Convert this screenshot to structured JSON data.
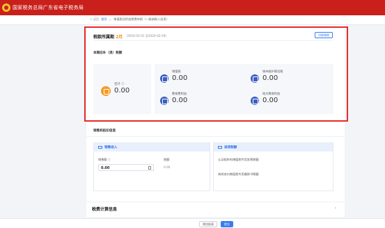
{
  "header": {
    "site_title": "国家税务总局广东省电子税务局"
  },
  "breadcrumb": {
    "back": "< 返回",
    "home": "首页",
    "separator": ">",
    "current": "增值税及附加税费申报（一般纳税人适用）"
  },
  "period": {
    "label": "税款所属期",
    "value": "2月",
    "range": "（2024-02-01 至2024-02-29）",
    "switch_button": "切换属期"
  },
  "summary": {
    "subtitle": "本期应补（退）税额",
    "total_label": "合计 ⓘ",
    "total_value": "0.00"
  },
  "taxes": [
    {
      "name": "增值税",
      "value": "0.00",
      "icon": "vat-icon"
    },
    {
      "name": "城市维护建设税",
      "value": "0.00",
      "icon": "city-tax-icon"
    },
    {
      "name": "教育费附加",
      "value": "0.00",
      "icon": "education-icon"
    },
    {
      "name": "地方教育附加",
      "value": "0.00",
      "icon": "local-education-icon"
    }
  ],
  "sales_section": {
    "title": "销售和抵扣信息",
    "sales_card": {
      "title": "销售收入",
      "sales_amount_label": "销售额 ⓘ",
      "sales_amount_value": "0.00",
      "tax_amount_label": "税额",
      "tax_amount_value": "0.00"
    },
    "deduct_card": {
      "title": "进项税额",
      "line1": "认证相符的增值税专用发票税额",
      "line2": "海关进口增值税专用缴款书税额"
    }
  },
  "tax_calc": {
    "title": "税费计算信息",
    "chevron": "›"
  },
  "footer": {
    "preview_button": "预览报表",
    "submit_button": "提交"
  },
  "colors": {
    "brand_red": "#c9201c",
    "highlight": "#e52a2a",
    "accent_blue": "#3a7bf2",
    "orange": "#f59a23"
  }
}
